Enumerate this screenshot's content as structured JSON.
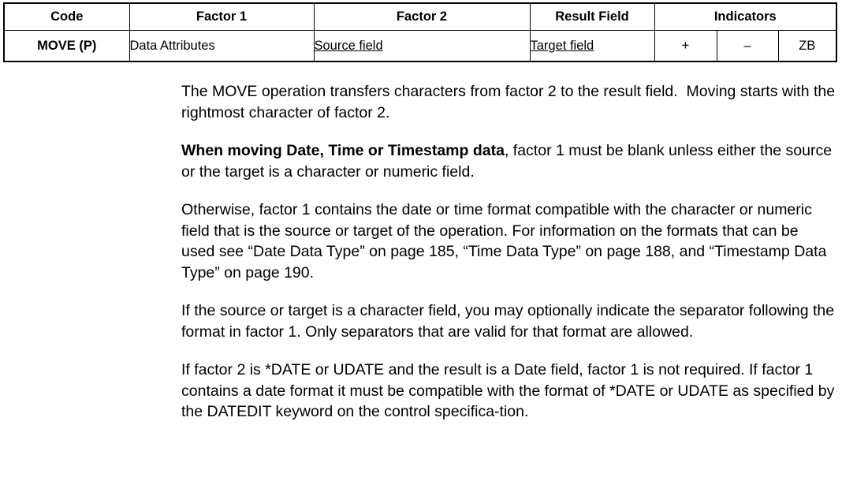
{
  "opcode_table": {
    "headers": [
      {
        "label": "Code",
        "key": "code"
      },
      {
        "label": "Factor 1",
        "key": "factor1"
      },
      {
        "label": "Factor 2",
        "key": "factor2"
      },
      {
        "label": "Result Field",
        "key": "result_field"
      },
      {
        "label": "Indicators",
        "key": "indicators"
      }
    ],
    "row": {
      "code": "MOVE (P)",
      "factor1": "Data Attributes",
      "factor2": "Source field",
      "result_field": "Target field",
      "indicator_plus": "+",
      "indicator_minus": "–",
      "indicator_zb": "ZB"
    }
  },
  "body": {
    "paragraphs": [
      {
        "id": "intro",
        "runs": [
          {
            "text": "The MOVE operation transfers characters from factor 2 to the result field.  Moving starts with the rightmost character of factor 2.",
            "bold": false
          }
        ]
      },
      {
        "id": "date-time-timestamp",
        "runs": [
          {
            "text": "When moving Date, Time or Timestamp data",
            "bold": true
          },
          {
            "text": ", factor 1 must be blank unless either the source or the target is a character or numeric field.",
            "bold": false
          }
        ]
      },
      {
        "id": "otherwise-formats",
        "runs": [
          {
            "text": "Otherwise, factor 1 contains the date or time format compatible with the character or numeric field that is the source or target of the operation. For information on the formats that can be used see “Date Data Type” on page 185, “Time Data Type” on page 188, and “Timestamp Data Type” on page 190.",
            "bold": false
          }
        ]
      },
      {
        "id": "separator",
        "runs": [
          {
            "text": "If the source or target is a character field, you may optionally indicate the separator following the format in factor 1. Only separators that are valid for that format are allowed.",
            "bold": false
          }
        ]
      },
      {
        "id": "date-udate",
        "runs": [
          {
            "text": "If factor 2 is *DATE or UDATE and the result is a Date field, factor 1 is not required. If factor 1 contains a date format it must be compatible with the format of *DATE or UDATE as specified by the DATEDIT keyword on the control specifica-tion.",
            "bold": false
          }
        ]
      }
    ]
  },
  "colors": {
    "text": "#000000",
    "rule": "#000000",
    "background": "#ffffff"
  }
}
